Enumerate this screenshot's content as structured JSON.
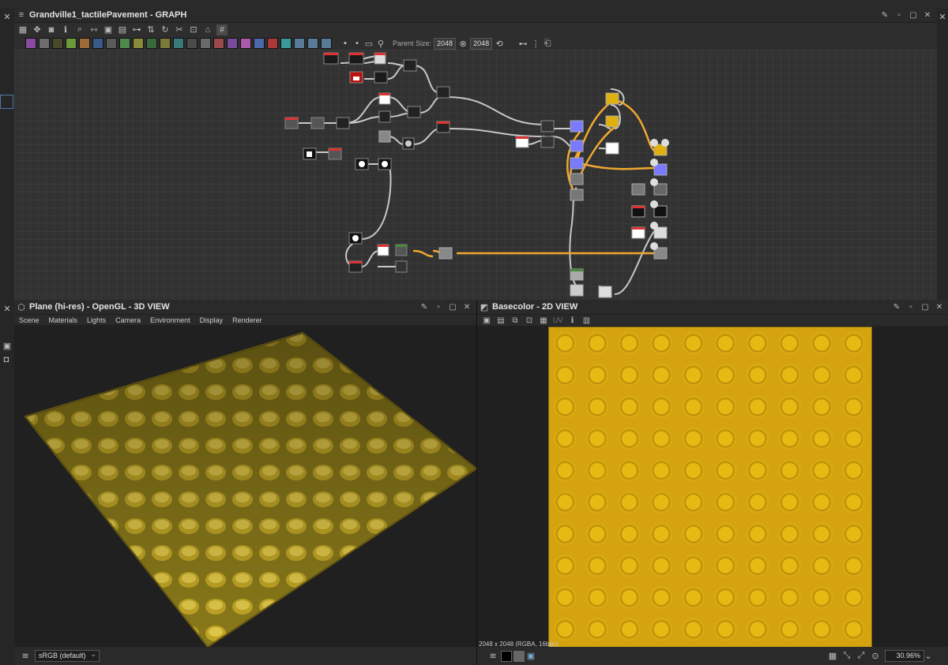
{
  "graph": {
    "title": "Grandville1_tactilePavement - GRAPH",
    "parent_size_label": "Parent Size:",
    "parent_size_value": "2048",
    "size_value": "2048",
    "toolbar_icons": [
      "grid-icon",
      "move-icon",
      "camera-icon",
      "info-icon",
      "search-icon",
      "link-icon",
      "frame-icon",
      "align-icon",
      "pin-icon",
      "refresh-icon",
      "tool-icon",
      "export-icon",
      "clean-icon",
      "snap-icon"
    ],
    "node_swatch_colors": [
      "#8a4aa0",
      "#6d6d6d",
      "#4a4a2a",
      "#6a9a3a",
      "#9e6a3a",
      "#3a5a8a",
      "#5a5a5a",
      "#4e8a4e",
      "#8a8a3a",
      "#3a6a3a",
      "#7a7a3a",
      "#3a7a7a",
      "#4a4a4a",
      "#6a6a6a",
      "#9a4a4a",
      "#7a4a9a",
      "#aa5aaa",
      "#4a6aaa",
      "#aa3a3a",
      "#3a9a9a",
      "#5a7a9a",
      "#5a7a9a",
      "#5a7a9a"
    ]
  },
  "view3d": {
    "title": "Plane (hi-res) - OpenGL - 3D VIEW",
    "menu": [
      "Scene",
      "Materials",
      "Lights",
      "Camera",
      "Environment",
      "Display",
      "Renderer"
    ],
    "colorspace": "sRGB (default)"
  },
  "view2d": {
    "title": "Basecolor - 2D VIEW",
    "uv_label": "UV",
    "status": "2048 x 2048 (RGBA, 16bpc)",
    "zoom": "30.96%"
  },
  "colors": {
    "accent_orange": "#f0a830",
    "texture_yellow": "#e0b010",
    "node_blue": "#7a7aff"
  }
}
